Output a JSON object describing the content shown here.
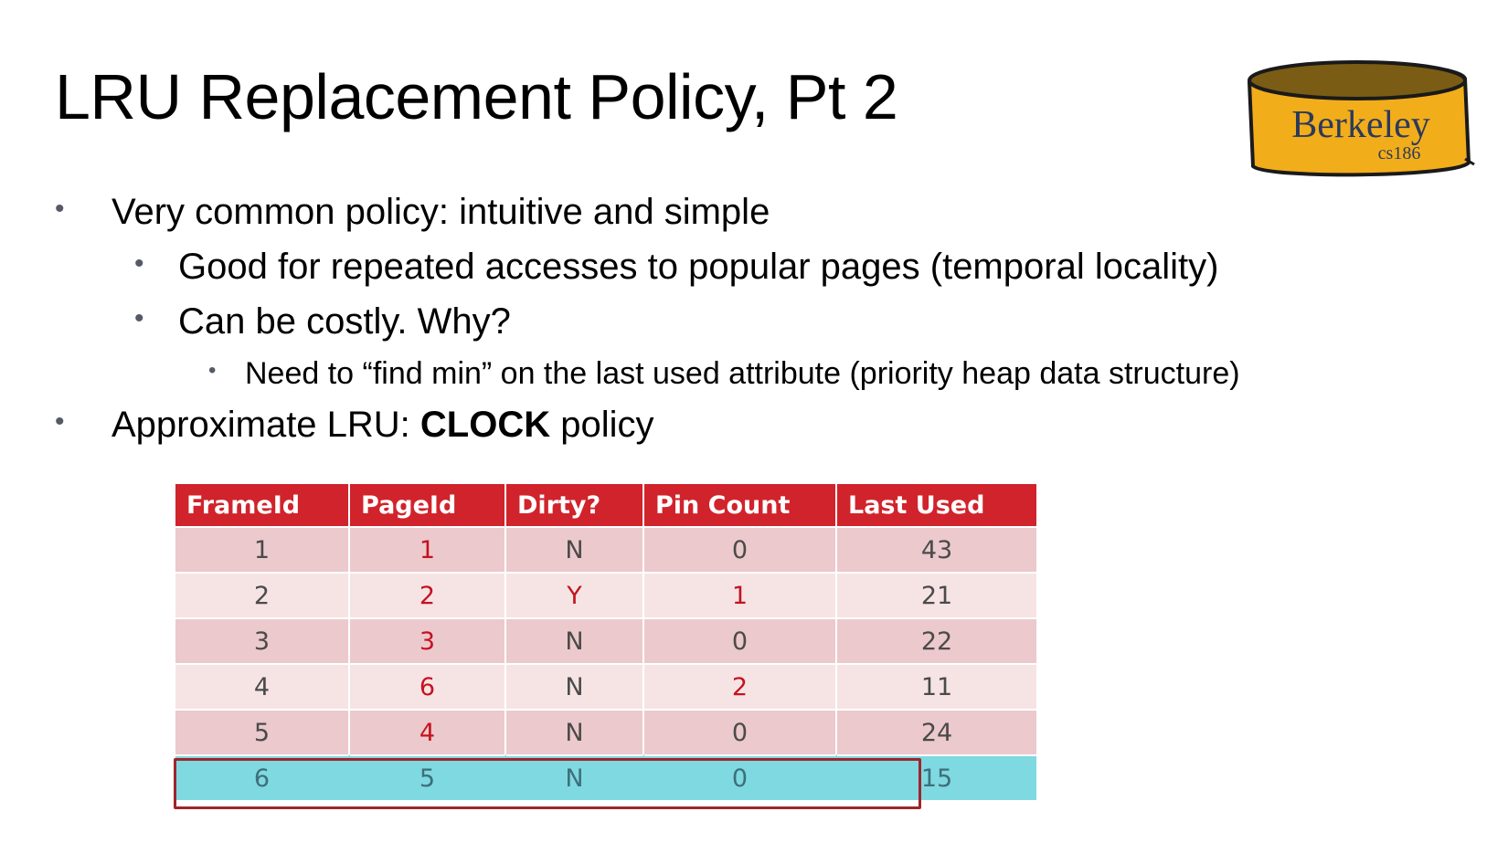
{
  "title": "LRU Replacement Policy, Pt 2",
  "logo": {
    "name": "Berkeley",
    "course": "cs186"
  },
  "bullets": {
    "b1": "Very common policy: intuitive and simple",
    "b2": "Good for repeated accesses to popular pages (temporal locality)",
    "b3": "Can be costly. Why?",
    "b4": "Need to “find min” on the last used attribute (priority heap data structure)",
    "b5_prefix": "Approximate LRU: ",
    "b5_bold": "CLOCK",
    "b5_suffix": " policy",
    "marker": "•"
  },
  "table": {
    "headers": [
      "FrameId",
      "PageId",
      "Dirty?",
      "Pin Count",
      "Last Used"
    ],
    "rows": [
      [
        "1",
        "1",
        "N",
        "0",
        "43"
      ],
      [
        "2",
        "2",
        "Y",
        "1",
        "21"
      ],
      [
        "3",
        "3",
        "N",
        "0",
        "22"
      ],
      [
        "4",
        "6",
        "N",
        "2",
        "11"
      ],
      [
        "5",
        "4",
        "N",
        "0",
        "24"
      ],
      [
        "6",
        "5",
        "N",
        "0",
        "15"
      ]
    ],
    "highlighted_row": 6
  },
  "colors": {
    "header_bg": "#d1232c",
    "row_odd": "#ecc9cc",
    "row_even": "#f6e4e5",
    "highlight": "#7fd9e0",
    "accent_text": "#c4131f",
    "logo_fill": "#f2ad1b"
  }
}
